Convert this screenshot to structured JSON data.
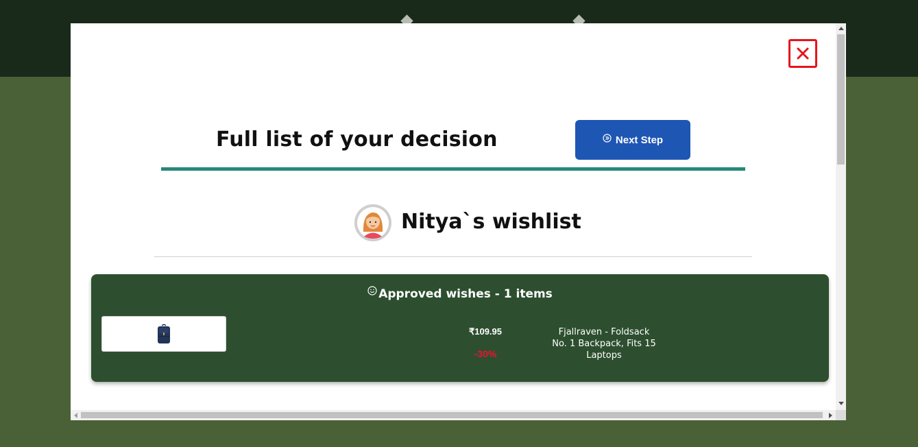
{
  "colors": {
    "background": "#4a6137",
    "header": "#1a2a1a",
    "accent_teal": "#27887c",
    "button_blue": "#1e56b4",
    "card_green": "#2d4f2f",
    "close_red": "#e8131b",
    "discount_red": "#ee1234"
  },
  "modal": {
    "close_icon": "close-x-icon",
    "title": "Full list of your decision",
    "next_button": {
      "label": "Next Step",
      "icon": "next-circle-icon"
    }
  },
  "wishlist": {
    "avatar_icon": "girl-avatar-icon",
    "title": "Nitya`s wishlist"
  },
  "approved": {
    "icon": "smile-icon",
    "title": "Approved wishes - 1 items",
    "items": [
      {
        "image_icon": "backpack-icon",
        "price": "₹109.95",
        "discount": "-30%",
        "name": "Fjallraven - Foldsack No. 1 Backpack, Fits 15 Laptops"
      }
    ]
  }
}
